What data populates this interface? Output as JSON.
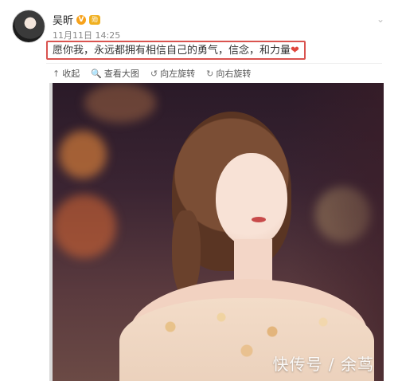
{
  "user": {
    "name": "吴昕",
    "verified_badge": "V",
    "rank_badge": "勋",
    "timestamp": "11月11日 14:25"
  },
  "post": {
    "text": "愿你我，永远都拥有相信自己的勇气，信念，和力量",
    "heart": "❤"
  },
  "toolbar": {
    "items": [
      {
        "icon": "↑",
        "label": "收起"
      },
      {
        "icon": "🔍",
        "label": "查看大图"
      },
      {
        "icon": "↺",
        "label": "向左旋转"
      },
      {
        "icon": "↻",
        "label": "向右旋转"
      }
    ]
  },
  "watermark": {
    "text": "快传号 / 余茑"
  },
  "icons": {
    "more": "chevron-down-icon",
    "collapse": "collapse-icon",
    "zoom": "magnifier-icon",
    "rotate_left": "rotate-left-icon",
    "rotate_right": "rotate-right-icon"
  },
  "colors": {
    "highlight_border": "#d9534f",
    "badge": "#f7a21b",
    "heart": "#e0463c"
  }
}
